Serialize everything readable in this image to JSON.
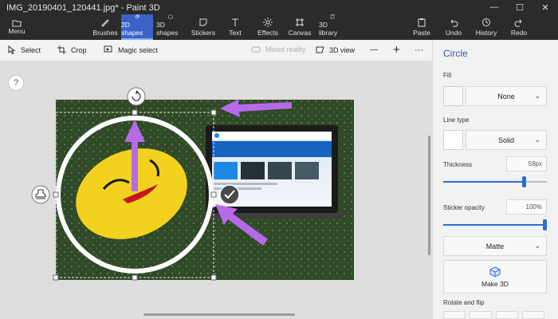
{
  "window": {
    "title": "IMG_20190401_120441.jpg* - Paint 3D",
    "controls": [
      "—",
      "☐",
      "✕"
    ]
  },
  "ribbon": {
    "menu_label": "Menu",
    "tools": [
      {
        "label": "Brushes",
        "icon": "brush-icon",
        "active": false
      },
      {
        "label": "2D shapes",
        "icon": "2d-shapes-icon",
        "active": true
      },
      {
        "label": "3D shapes",
        "icon": "3d-shapes-icon",
        "active": false
      },
      {
        "label": "Stickers",
        "icon": "stickers-icon",
        "active": false
      },
      {
        "label": "Text",
        "icon": "text-icon",
        "active": false
      },
      {
        "label": "Effects",
        "icon": "effects-icon",
        "active": false
      },
      {
        "label": "Canvas",
        "icon": "canvas-icon",
        "active": false
      },
      {
        "label": "3D library",
        "icon": "3d-library-icon",
        "active": false
      }
    ],
    "right_tools": [
      {
        "label": "Paste",
        "icon": "paste-icon"
      },
      {
        "label": "Undo",
        "icon": "undo-icon"
      },
      {
        "label": "History",
        "icon": "history-icon"
      },
      {
        "label": "Redo",
        "icon": "redo-icon"
      }
    ]
  },
  "subbar": {
    "select": "Select",
    "crop": "Crop",
    "magic_select": "Magic select",
    "mixed_reality": "Mixed reality",
    "view_3d": "3D view",
    "zoom_out": "—",
    "zoom_in": "+",
    "more": "···"
  },
  "canvas": {
    "help": "?"
  },
  "panel": {
    "title": "Circle",
    "fill_label": "Fill",
    "fill_value": "None",
    "line_type_label": "Line type",
    "line_type_value": "Solid",
    "thickness_label": "Thickness",
    "thickness_value": "59px",
    "thickness_level": 0.78,
    "opacity_label": "Sticker opacity",
    "opacity_value": "100%",
    "opacity_level": 1.0,
    "finish_value": "Matte",
    "make3d_label": "Make 3D",
    "rotate_label": "Rotate and flip"
  },
  "colors": {
    "accent": "#3a63c9",
    "slider": "#2a6fd6",
    "annotation_arrow": "#b66ae8",
    "carpet": "#2f4a26",
    "pillow": "#f2d21e"
  }
}
